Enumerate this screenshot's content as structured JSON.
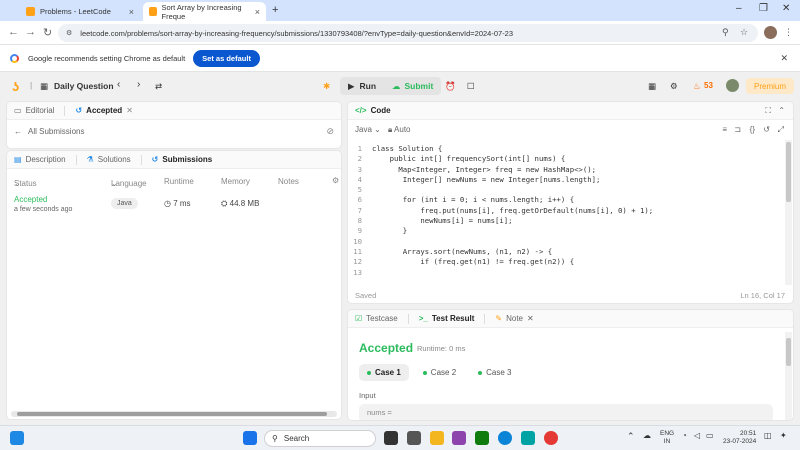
{
  "browser": {
    "tabs": [
      {
        "title": "Problems - LeetCode",
        "active": false
      },
      {
        "title": "Sort Array by Increasing Freque",
        "active": true
      }
    ],
    "url": "leetcode.com/problems/sort-array-by-increasing-frequency/submissions/1330793408/?envType=daily-question&envId=2024-07-23"
  },
  "banner": {
    "text": "Google recommends setting Chrome as default",
    "button": "Set as default"
  },
  "lcnav": {
    "daily_question": "Daily Question",
    "run": "Run",
    "submit": "Submit",
    "streak": "53",
    "premium": "Premium"
  },
  "left_top": {
    "tabs": [
      "Editorial",
      "Accepted"
    ],
    "all_submissions": "All Submissions"
  },
  "left_bottom": {
    "tabs": [
      "Description",
      "Solutions",
      "Submissions"
    ],
    "columns": [
      "Status",
      "Language",
      "Runtime",
      "Memory",
      "Notes"
    ],
    "row": {
      "status": "Accepted",
      "time": "a few seconds ago",
      "language": "Java",
      "runtime": "7 ms",
      "memory": "44.8 MB"
    }
  },
  "code": {
    "title": "Code",
    "language": "Java",
    "mode": "Auto",
    "saved": "Saved",
    "cursor": "Ln 16, Col 17",
    "lines": [
      "class Solution {",
      "    public int[] frequencySort(int[] nums) {",
      "      Map<Integer, Integer> freq = new HashMap<>();",
      "       Integer[] newNums = new Integer[nums.length];",
      "",
      "       for (int i = 0; i < nums.length; i++) {",
      "           freq.put(nums[i], freq.getOrDefault(nums[i], 0) + 1);",
      "           newNums[i] = nums[i];",
      "       }",
      "",
      "       Arrays.sort(newNums, (n1, n2) -> {",
      "           if (freq.get(n1) != freq.get(n2)) {",
      ""
    ]
  },
  "test": {
    "tabs": [
      "Testcase",
      "Test Result",
      "Note"
    ],
    "result": "Accepted",
    "runtime": "Runtime: 0 ms",
    "cases": [
      "Case 1",
      "Case 2",
      "Case 3"
    ],
    "input_label": "Input",
    "input_value": "nums ="
  },
  "taskbar": {
    "search": "Search",
    "lang_top": "ENG",
    "lang_bottom": "IN",
    "time": "20:51",
    "date": "23-07-2024"
  }
}
